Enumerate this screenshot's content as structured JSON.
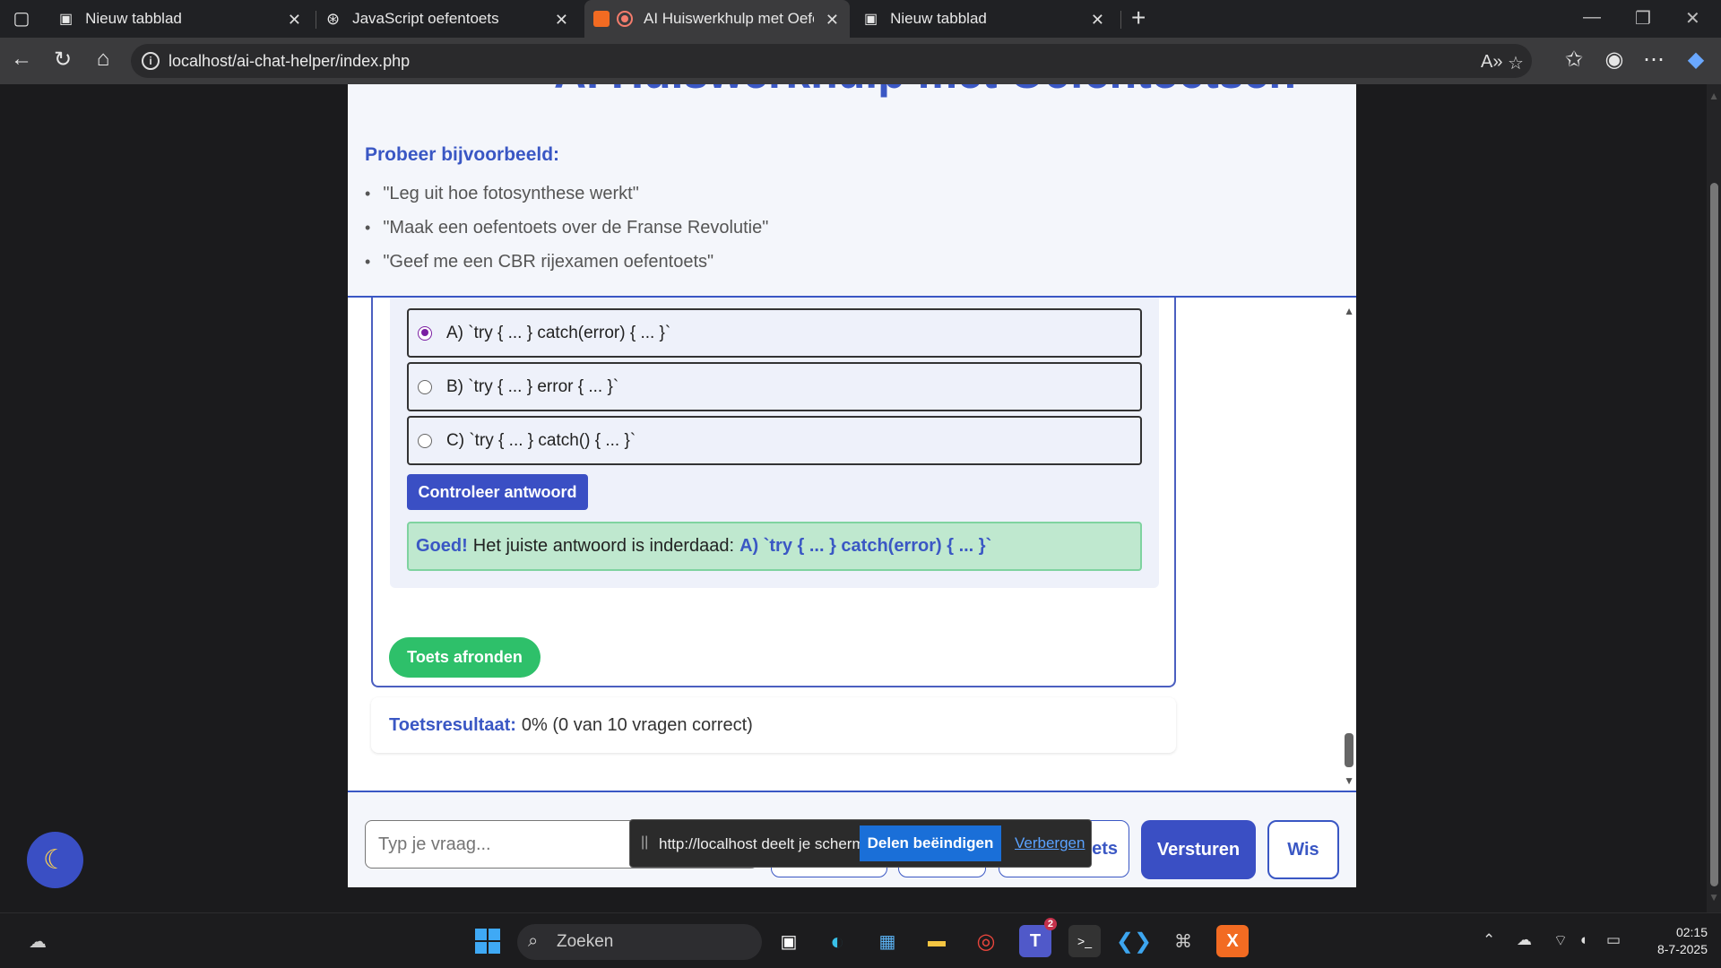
{
  "browser": {
    "tabs": [
      {
        "title": "Nieuw tabblad",
        "icon": "newtab-icon"
      },
      {
        "title": "JavaScript oefentoets",
        "icon": "chatgpt-icon"
      },
      {
        "title": "AI Huiswerkhulp met Oefent",
        "icon": "recording-icon"
      },
      {
        "title": "Nieuw tabblad",
        "icon": "newtab-icon"
      }
    ],
    "url": "localhost/ai-chat-helper/index.php"
  },
  "page": {
    "title": "AI Huiswerkhulp met Oefentoetsen",
    "examples_title": "Probeer bijvoorbeeld:",
    "examples": [
      "\"Leg uit hoe fotosynthese werkt\"",
      "\"Maak een oefentoets over de Franse Revolutie\"",
      "\"Geef me een CBR rijexamen oefentoets\""
    ]
  },
  "quiz": {
    "options": [
      {
        "label": "A) `try { ... } catch(error) { ... }`",
        "checked": true
      },
      {
        "label": "B) `try { ... } error { ... }`",
        "checked": false
      },
      {
        "label": "C) `try { ... } catch() { ... }`",
        "checked": false
      }
    ],
    "check_button": "Controleer antwoord",
    "feedback": {
      "good": "Goed!",
      "text": "Het juiste antwoord is inderdaad:",
      "answer": "A) `try { ... } catch(error) { ... }`"
    },
    "finish_button": "Toets afronden"
  },
  "result": {
    "label": "Toetsresultaat:",
    "value": "0% (0 van 10 vragen correct)"
  },
  "input": {
    "placeholder": "Typ je vraag...",
    "send_button": "Versturen",
    "clear_button": "Wis",
    "hidden_button_partial": "ets"
  },
  "share_bar": {
    "message": "http://localhost deelt je scherm.",
    "stop": "Delen beëindigen",
    "hide": "Verbergen"
  },
  "taskbar": {
    "search_placeholder": "Zoeken",
    "teams_badge": "2",
    "time": "02:15",
    "date": "8-7-2025"
  },
  "colors": {
    "accent": "#3a57c4",
    "success": "#2ec06a",
    "feedback_bg": "#bfe8cf"
  }
}
